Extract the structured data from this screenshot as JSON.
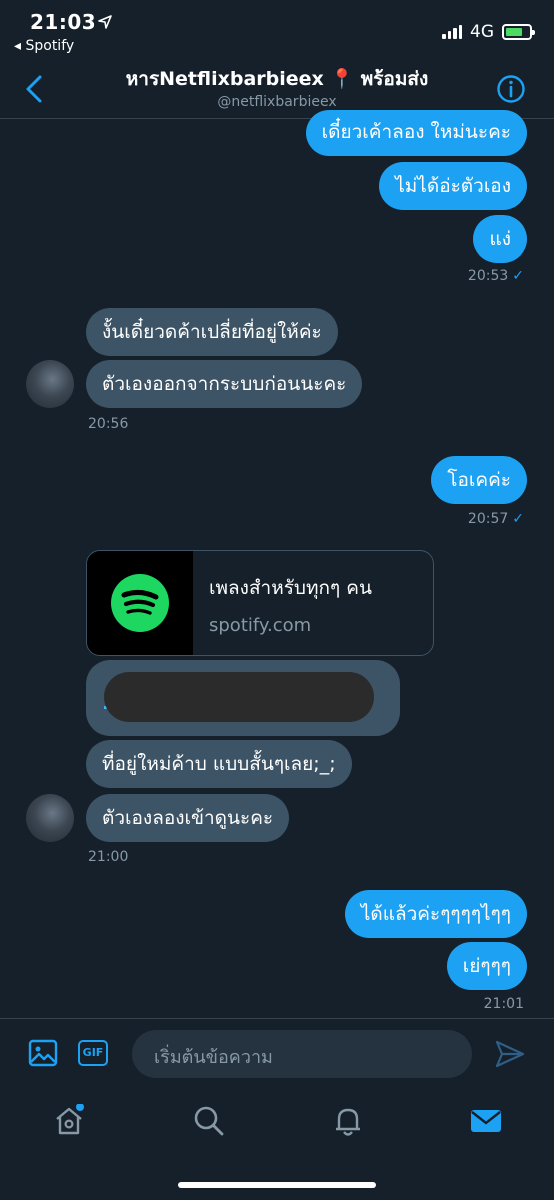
{
  "status": {
    "time": "21:03",
    "back_app": "◂ Spotify",
    "network": "4G"
  },
  "header": {
    "title": "หารNetflixbarbieex 📍 พร้อมส่ง",
    "handle": "@netflixbarbieex"
  },
  "messages": {
    "out1": "เดี๋ยวเค้าลอง ใหม่นะคะ",
    "out2": "ไม่ได้อ่ะตัวเอง",
    "out3": "แง่",
    "time1": "20:53",
    "in1": "งั้นเดี๋ยวดค้าเปลี่ยที่อยู่ให้ค่ะ",
    "in2": "ตัวเองออกจากระบบก่อนนะคะ",
    "time2": "20:56",
    "out4": "โอเคค่ะ",
    "time3": "20:57",
    "link_card": {
      "title": "เพลงสำหรับทุกๆ คน",
      "url": "spotify.com"
    },
    "in3": "ที่อยู่ใหม่ค้าบ แบบสั้นๆเลย;_;",
    "in4": "ตัวเองลองเข้าดูนะคะ",
    "time4": "21:00",
    "out5": "ได้แล้วค่ะๆๆๆๆไๆๆ",
    "out6": "เย่ๆๆๆ",
    "time5": "21:01",
    "check": "✓"
  },
  "composer": {
    "placeholder": "เริ่มต้นข้อความ",
    "gif_label": "GIF"
  },
  "colors": {
    "background": "#15202b",
    "accent": "#1da1f2",
    "incoming_bubble": "#3d5466",
    "spotify_green": "#1ed760"
  }
}
